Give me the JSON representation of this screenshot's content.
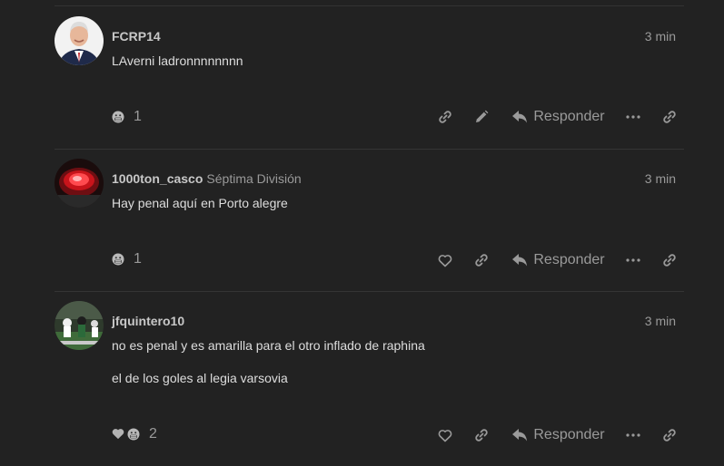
{
  "posts": [
    {
      "username": "FCRP14",
      "user_title": "",
      "time": "3 min",
      "paragraphs": [
        "LAverni ladronnnnnnnn"
      ],
      "reactions": {
        "emojis": [
          "grimacing-face"
        ],
        "count": "1"
      },
      "actions": [
        "link-icon",
        "pencil-icon"
      ],
      "reply_label": "Responder"
    },
    {
      "username": "1000ton_casco",
      "user_title": "Séptima División",
      "time": "3 min",
      "paragraphs": [
        "Hay penal aquí en Porto alegre"
      ],
      "reactions": {
        "emojis": [
          "grimacing-face"
        ],
        "count": "1"
      },
      "actions": [
        "heart-icon",
        "link-icon"
      ],
      "reply_label": "Responder"
    },
    {
      "username": "jfquintero10",
      "user_title": "",
      "time": "3 min",
      "paragraphs": [
        "no es penal y es amarilla para el otro inflado de raphina",
        "el de los goles al legia varsovia"
      ],
      "reactions": {
        "emojis": [
          "grey-heart",
          "grimacing-face"
        ],
        "count": "2"
      },
      "actions": [
        "heart-icon",
        "link-icon"
      ],
      "reply_label": "Responder"
    }
  ],
  "colors": {
    "background": "#222222",
    "text": "#dddddd",
    "muted": "#9a9a9a",
    "separator": "#353535"
  }
}
